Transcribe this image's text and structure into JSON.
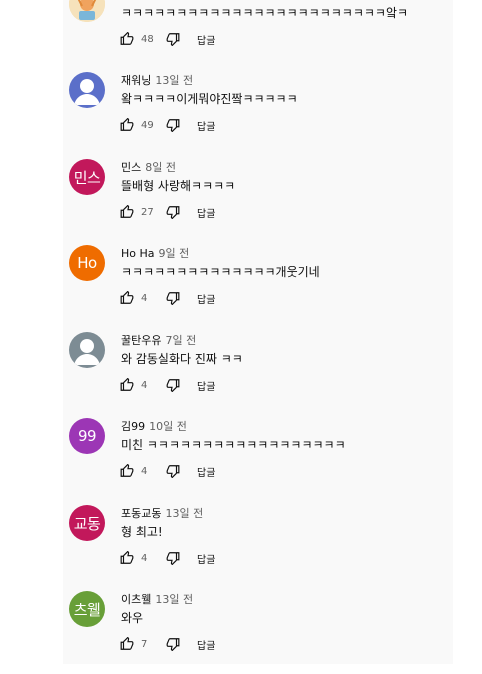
{
  "icons": {
    "like": "thumb-up-outline-icon",
    "dislike": "thumb-down-outline-icon"
  },
  "colors": {
    "panel_bg": "#f9f9f9",
    "secondary_text": "#606060"
  },
  "reply_label": "답글",
  "top_partial": {
    "text": "ㅋㅋㅋㅋㅋㅋㅋㅋㅋㅋㅋㅋㅋㅋㅋㅋㅋㅋㅋㅋㅋㅋㅋㅋ앜ㅋ",
    "likes": "48",
    "avatar_color": "#f3d9a6"
  },
  "comments": [
    {
      "author": "재워닝",
      "time": "13일 전",
      "text": "왘ㅋㅋㅋㅋ이게뭐야진짴ㅋㅋㅋㅋㅋ",
      "likes": "49",
      "avatar_type": "default",
      "avatar_color": "#5b6fc9",
      "avatar_text": ""
    },
    {
      "author": "민스",
      "time": "8일 전",
      "text": "뜰배형 사랑해ㅋㅋㅋㅋ",
      "likes": "27",
      "avatar_type": "letter",
      "avatar_color": "#c2185b",
      "avatar_text": "민스"
    },
    {
      "author": "Ho Ha",
      "time": "9일 전",
      "text": "ㅋㅋㅋㅋㅋㅋㅋㅋㅋㅋㅋㅋㅋㅋ개웃기네",
      "likes": "4",
      "avatar_type": "letter",
      "avatar_color": "#ef6c00",
      "avatar_text": "Ho"
    },
    {
      "author": "꿀탄우유",
      "time": "7일 전",
      "text": "와 감동실화다 진짜 ㅋㅋ",
      "likes": "4",
      "avatar_type": "default",
      "avatar_color": "#7d8c94",
      "avatar_text": ""
    },
    {
      "author": "김99",
      "time": "10일 전",
      "text": "미친 ㅋㅋㅋㅋㅋㅋㅋㅋㅋㅋㅋㅋㅋㅋㅋㅋㅋㅋ",
      "likes": "4",
      "avatar_type": "letter",
      "avatar_color": "#9c36b5",
      "avatar_text": "99"
    },
    {
      "author": "포동교동",
      "time": "13일 전",
      "text": "형 최고!",
      "likes": "4",
      "avatar_type": "letter",
      "avatar_color": "#c2185b",
      "avatar_text": "교동"
    },
    {
      "author": "이츠웰",
      "time": "13일 전",
      "text": "와우",
      "likes": "7",
      "avatar_type": "letter",
      "avatar_color": "#689f38",
      "avatar_text": "츠웰"
    }
  ]
}
